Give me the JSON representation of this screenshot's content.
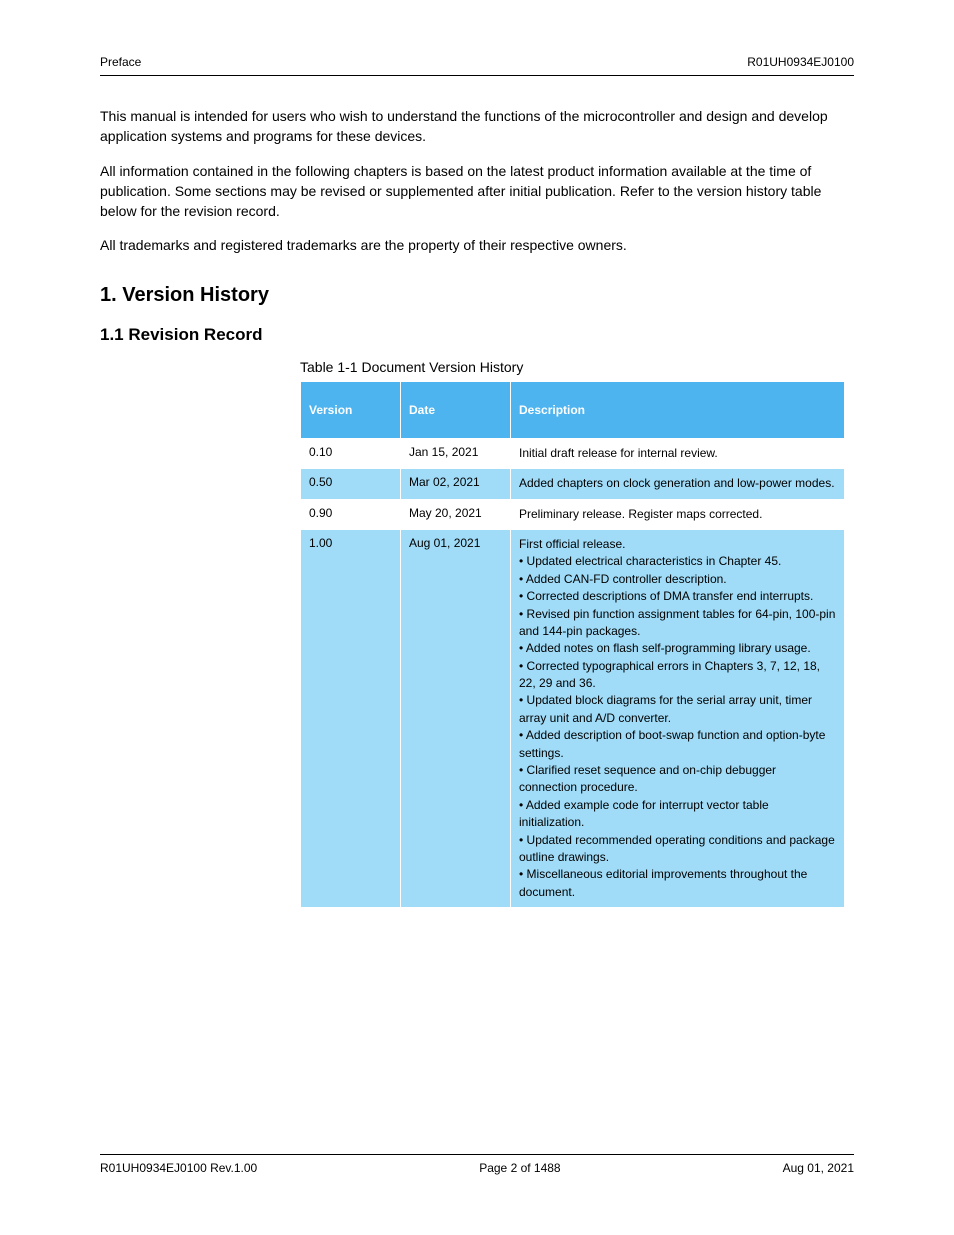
{
  "header": {
    "left": "Preface",
    "right": "R01UH0934EJ0100"
  },
  "intro": {
    "p1": "This manual is intended for users who wish to understand the functions of the microcontroller and design and develop application systems and programs for these devices.",
    "p2": "All information contained in the following chapters is based on the latest product information available at the time of publication. Some sections may be revised or supplemented after initial publication. Refer to the version history table below for the revision record.",
    "p3": "All trademarks and registered trademarks are the property of their respective owners."
  },
  "section_title": "1.  Version History",
  "subsection_title": "1.1  Revision Record",
  "table_caption": "Table 1-1  Document Version History",
  "table": {
    "headers": [
      "Version",
      "Date",
      "Description"
    ],
    "rows": [
      {
        "ver": "0.10",
        "date": "Jan 15, 2021",
        "desc": "Initial draft release for internal review."
      },
      {
        "ver": "0.50",
        "date": "Mar 02, 2021",
        "desc": "Added chapters on clock generation and low-power modes."
      },
      {
        "ver": "0.90",
        "date": "May 20, 2021",
        "desc": "Preliminary release. Register maps corrected."
      },
      {
        "ver": "1.00",
        "date": "Aug 01, 2021",
        "desc": "First official release.\n• Updated electrical characteristics in Chapter 45.\n• Added CAN-FD controller description.\n• Corrected descriptions of DMA transfer end interrupts.\n• Revised pin function assignment tables for 64-pin, 100-pin and 144-pin packages.\n• Added notes on flash self-programming library usage.\n• Corrected typographical errors in Chapters 3, 7, 12, 18, 22, 29 and 36.\n• Updated block diagrams for the serial array unit, timer array unit and A/D converter.\n• Added description of boot-swap function and option-byte settings.\n• Clarified reset sequence and on-chip debugger connection procedure.\n• Added example code for interrupt vector table initialization.\n• Updated recommended operating conditions and package outline drawings.\n• Miscellaneous editorial improvements throughout the document."
      }
    ]
  },
  "footer": {
    "left": "R01UH0934EJ0100  Rev.1.00",
    "mid": "Page 2 of 1488",
    "right": "Aug 01, 2021"
  }
}
